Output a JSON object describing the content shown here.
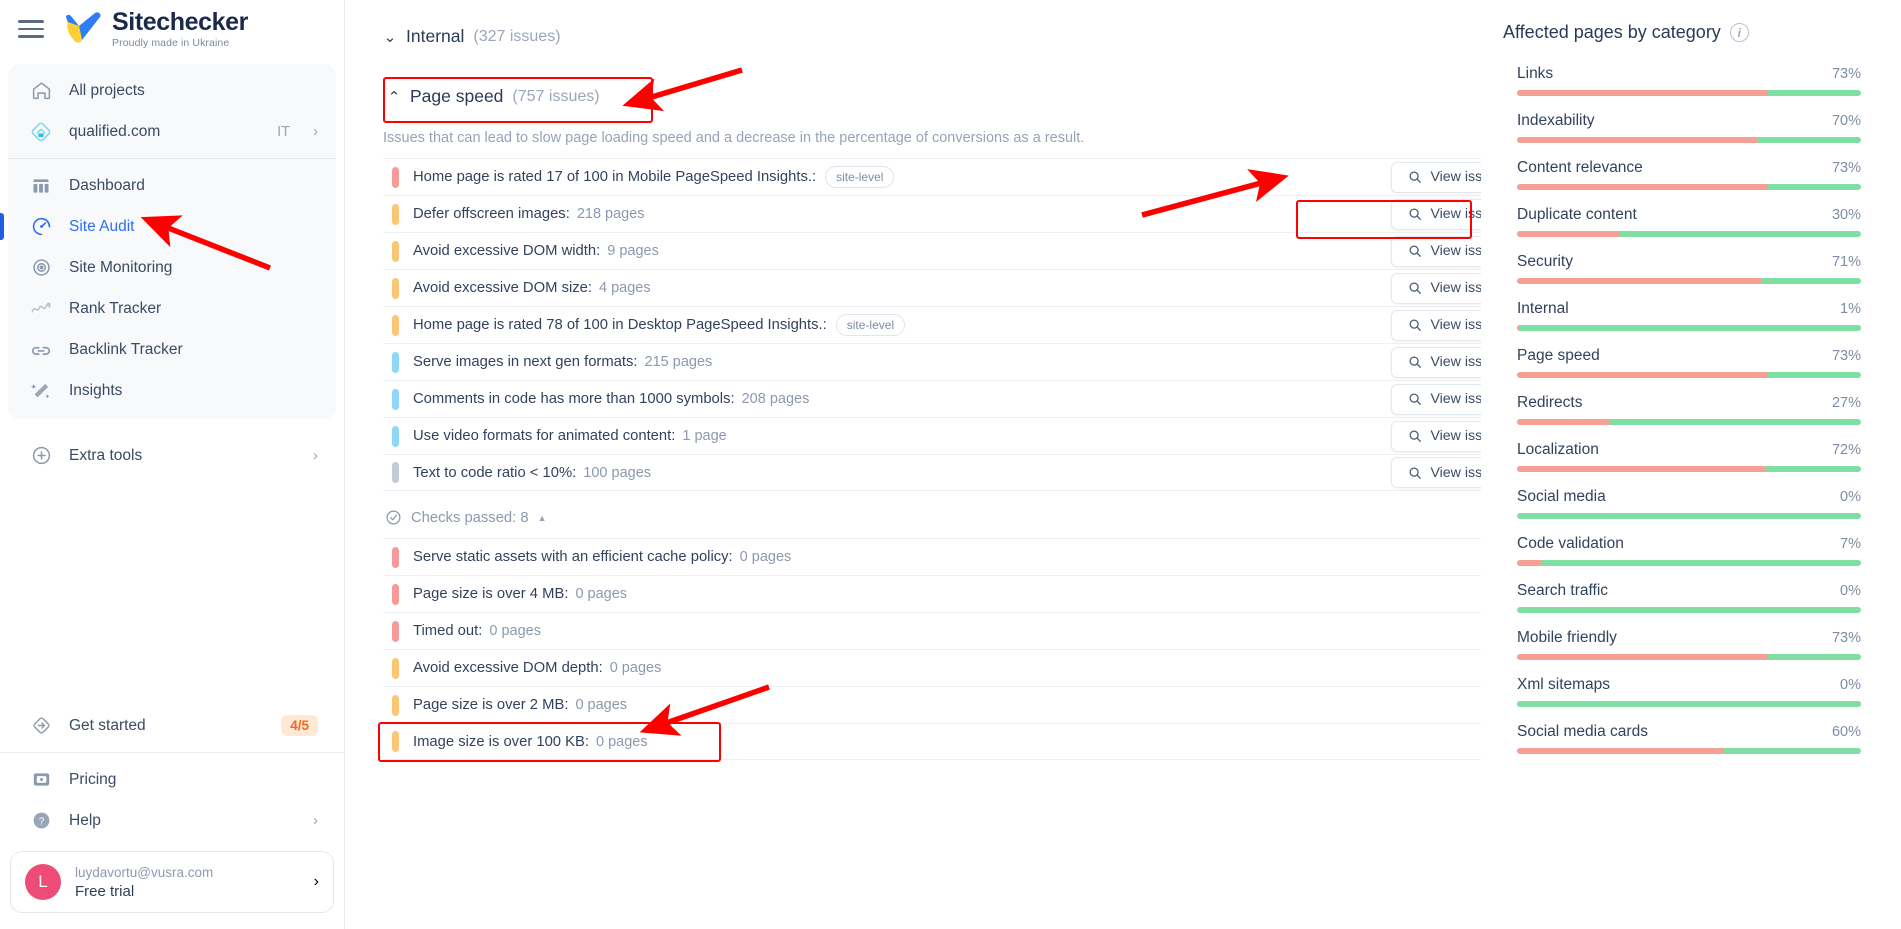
{
  "brand": {
    "name": "Sitechecker",
    "tagline": "Proudly made in Ukraine",
    "accent": "#2f6fed",
    "logo_blue": "#2f7df5",
    "logo_yellow": "#ffcf33"
  },
  "sidebar": {
    "menu_icon": "hamburger-icon",
    "primary": [
      {
        "label": "All projects",
        "icon": "home-icon",
        "active": false,
        "chevron": false,
        "suffix": ""
      },
      {
        "label": "qualified.com",
        "icon": "project-icon",
        "active": false,
        "chevron": true,
        "suffix": "IT"
      }
    ],
    "sections": [
      {
        "label": "Dashboard",
        "icon": "dashboard-icon",
        "active": false,
        "chevron": false
      },
      {
        "label": "Site Audit",
        "icon": "site-audit-icon",
        "active": true,
        "chevron": false
      },
      {
        "label": "Site Monitoring",
        "icon": "site-monitoring-icon",
        "active": false,
        "chevron": false
      },
      {
        "label": "Rank Tracker",
        "icon": "rank-tracker-icon",
        "active": false,
        "chevron": false
      },
      {
        "label": "Backlink Tracker",
        "icon": "backlink-tracker-icon",
        "active": false,
        "chevron": false
      },
      {
        "label": "Insights",
        "icon": "insights-icon",
        "active": false,
        "chevron": false
      }
    ],
    "extra": {
      "label": "Extra tools",
      "icon": "plus-circle-icon",
      "chevron": true
    },
    "get_started": {
      "label": "Get started",
      "icon": "get-started-icon",
      "badge": "4/5"
    },
    "footer": [
      {
        "label": "Pricing",
        "icon": "pricing-icon",
        "chevron": false
      },
      {
        "label": "Help",
        "icon": "help-icon",
        "chevron": true
      }
    ],
    "account": {
      "avatar_letter": "L",
      "email": "luydavortu@vusra.com",
      "plan": "Free trial",
      "chevron": "›"
    }
  },
  "main": {
    "internal_group": {
      "chevron": "collapsed-down",
      "name": "Internal",
      "count": "(327 issues)"
    },
    "page_speed_group": {
      "chevron": "expanded-up",
      "name": "Page speed",
      "count": "(757 issues)",
      "description": "Issues that can lead to slow page loading speed and a decrease in the percentage of conversions as a result."
    },
    "view_issue_label": "View issue",
    "site_level_badge": "site-level",
    "issues": [
      {
        "severity": "critical",
        "title": "Home page is rated 17 of 100 in Mobile PageSpeed Insights.:",
        "pages": "",
        "badge": "site-level",
        "action": "View issue"
      },
      {
        "severity": "warning",
        "title": "Defer offscreen images:",
        "pages": "218 pages",
        "badge": "",
        "action": "View issue"
      },
      {
        "severity": "warning",
        "title": "Avoid excessive DOM width:",
        "pages": "9 pages",
        "badge": "",
        "action": "View issue"
      },
      {
        "severity": "warning",
        "title": "Avoid excessive DOM size:",
        "pages": "4 pages",
        "badge": "",
        "action": "View issue"
      },
      {
        "severity": "warning",
        "title": "Home page is rated 78 of 100 in Desktop PageSpeed Insights.:",
        "pages": "",
        "badge": "site-level",
        "action": "View issue"
      },
      {
        "severity": "notice",
        "title": "Serve images in next gen formats:",
        "pages": "215 pages",
        "badge": "",
        "action": "View issue"
      },
      {
        "severity": "notice",
        "title": "Comments in code has more than 1000 symbols:",
        "pages": "208 pages",
        "badge": "",
        "action": "View issue"
      },
      {
        "severity": "notice",
        "title": "Use video formats for animated content:",
        "pages": "1 page",
        "badge": "",
        "action": "View issue"
      },
      {
        "severity": "info",
        "title": "Text to code ratio < 10%:",
        "pages": "100 pages",
        "badge": "",
        "action": "View issue"
      }
    ],
    "checks_passed": {
      "icon": "check-circle-icon",
      "label": "Checks passed: 8",
      "caret": "▲"
    },
    "passed_items": [
      {
        "severity": "critical",
        "title": "Serve static assets with an efficient cache policy:",
        "pages": "0 pages"
      },
      {
        "severity": "critical",
        "title": "Page size is over 4 MB:",
        "pages": "0 pages"
      },
      {
        "severity": "critical",
        "title": "Timed out:",
        "pages": "0 pages"
      },
      {
        "severity": "warning",
        "title": "Avoid excessive DOM depth:",
        "pages": "0 pages"
      },
      {
        "severity": "warning",
        "title": "Page size is over 2 MB:",
        "pages": "0 pages"
      },
      {
        "severity": "warning",
        "title": "Image size is over 100 KB:",
        "pages": "0 pages"
      }
    ]
  },
  "right_panel": {
    "title": "Affected pages by category",
    "info_icon": "info-icon",
    "chart_data": {
      "type": "bar",
      "title": "Affected pages by category",
      "xlabel": "",
      "ylabel": "",
      "orientation": "horizontal",
      "unit": "%",
      "xlim": [
        0,
        100
      ],
      "grid": false,
      "legend": "none",
      "affected_color": "#f6a095",
      "remaining_color": "#7fdfa2",
      "categories": [
        "Links",
        "Indexability",
        "Content relevance",
        "Duplicate content",
        "Security",
        "Internal",
        "Page speed",
        "Redirects",
        "Localization",
        "Social media",
        "Code validation",
        "Search traffic",
        "Mobile friendly",
        "Xml sitemaps",
        "Social media cards"
      ],
      "values": [
        73,
        70,
        73,
        30,
        71,
        1,
        73,
        27,
        72,
        0,
        7,
        0,
        73,
        0,
        60
      ],
      "labels": [
        "73%",
        "70%",
        "73%",
        "30%",
        "71%",
        "1%",
        "73%",
        "27%",
        "72%",
        "0%",
        "7%",
        "0%",
        "73%",
        "0%",
        "60%"
      ]
    }
  },
  "annotations": {
    "highlights": [
      "page-speed-header",
      "view-issue-first-row",
      "image-size-row"
    ],
    "arrows": [
      "arrow-to-page-speed",
      "arrow-to-site-audit",
      "arrow-to-view-issue",
      "arrow-to-image-size"
    ],
    "color": "#ff0000"
  }
}
